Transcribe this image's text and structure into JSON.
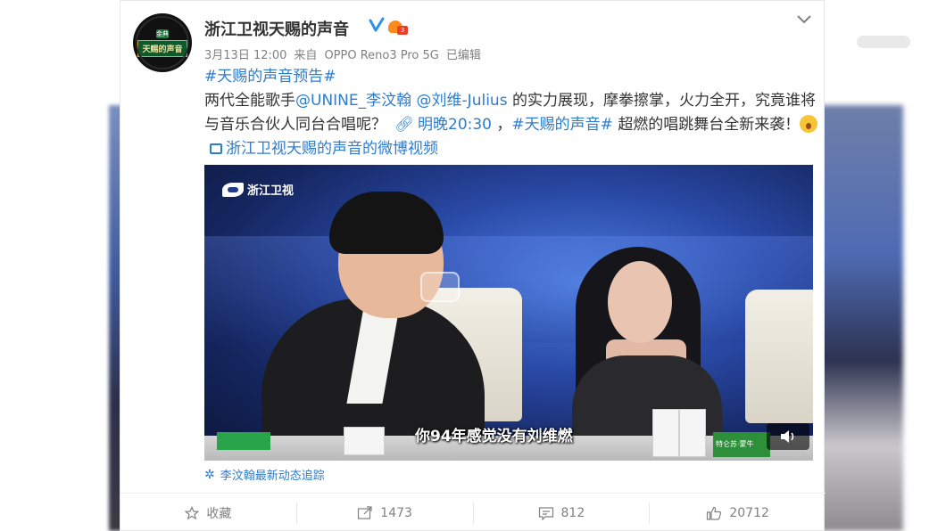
{
  "post": {
    "author": "浙江卫视天赐的声音",
    "verified_icon": "verified-badge-icon",
    "avatar_text": "天赐的声音",
    "avatar_badge": "金典",
    "date": "3月13日 12:00",
    "source_prefix": "来自",
    "source": "OPPO Reno3 Pro 5G",
    "edited": "已编辑",
    "hashtag_top": "#天赐的声音预告#",
    "text_1": "两代全能歌手",
    "mention_1": "@UNINE_李汶翰",
    "mention_2": "@刘维-Julius",
    "text_2": "的实力展现，摩拳擦掌，火力全开，究竟谁将与音乐合伙人同台合唱呢？",
    "time_link": "明晚20:30",
    "comma": "，",
    "hashtag_inline": "#天赐的声音#",
    "text_3": "超燃的唱跳舞台全新来袭！",
    "video_link": "浙江卫视天赐的声音的微博视频"
  },
  "video": {
    "station_logo": "浙江卫视",
    "subtitle": "你94年感觉没有刘维燃",
    "sign_text": "特仑苏·蒙牛",
    "mute_icon": "speaker-icon"
  },
  "tracking": {
    "label": "李汶翰最新动态追踪"
  },
  "actions": {
    "favorite_label": "收藏",
    "repost_count": "1473",
    "comment_count": "812",
    "like_count": "20712"
  },
  "colors": {
    "link": "#2e7ccc",
    "text": "#333333",
    "meta": "#808080"
  }
}
